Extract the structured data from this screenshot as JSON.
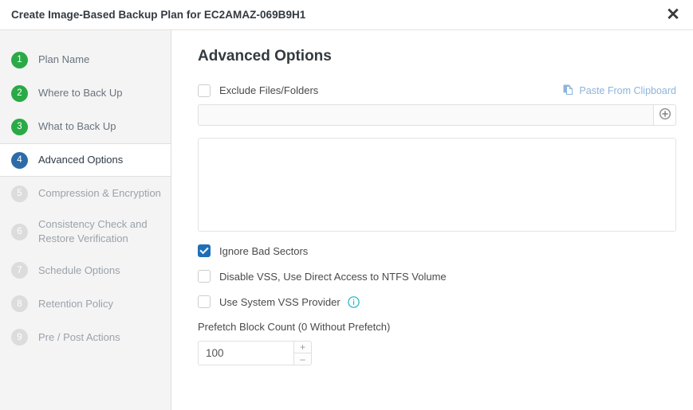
{
  "window": {
    "title": "Create Image-Based Backup Plan for EC2AMAZ-069B9H1",
    "close_label": "✕"
  },
  "sidebar": {
    "items": [
      {
        "number": "1",
        "label": "Plan Name",
        "state": "done"
      },
      {
        "number": "2",
        "label": "Where to Back Up",
        "state": "done"
      },
      {
        "number": "3",
        "label": "What to Back Up",
        "state": "done"
      },
      {
        "number": "4",
        "label": "Advanced Options",
        "state": "active"
      },
      {
        "number": "5",
        "label": "Compression & Encryption",
        "state": "todo"
      },
      {
        "number": "6",
        "label": "Consistency Check and Restore Verification",
        "state": "todo"
      },
      {
        "number": "7",
        "label": "Schedule Options",
        "state": "todo"
      },
      {
        "number": "8",
        "label": "Retention Policy",
        "state": "todo"
      },
      {
        "number": "9",
        "label": "Pre / Post Actions",
        "state": "todo"
      }
    ]
  },
  "main": {
    "heading": "Advanced Options",
    "exclude": {
      "checkbox_label": "Exclude Files/Folders",
      "checked": false,
      "paste_link_label": "Paste From Clipboard",
      "input_value": "",
      "input_placeholder": "",
      "add_button_label": "+",
      "textarea_value": "",
      "textarea_placeholder": ""
    },
    "options": [
      {
        "label": "Ignore Bad Sectors",
        "checked": true,
        "info": false
      },
      {
        "label": "Disable VSS, Use Direct Access to NTFS Volume",
        "checked": false,
        "info": false
      },
      {
        "label": "Use System VSS Provider",
        "checked": false,
        "info": true
      }
    ],
    "prefetch": {
      "label": "Prefetch Block Count (0 Without Prefetch)",
      "value": "100",
      "increment_label": "+",
      "decrement_label": "–"
    }
  },
  "colors": {
    "step_done": "#2aaa47",
    "step_active": "#2b6ca8",
    "step_todo": "#dcdcdc",
    "checkbox_checked": "#1f6fb6",
    "link": "#8cb4dc",
    "info_icon": "#29b6c8",
    "sidebar_bg": "#f4f4f4"
  },
  "icons": {
    "close": "close-icon",
    "paste": "paste-from-clipboard-icon",
    "add": "circle-plus-icon",
    "info": "info-circle-icon"
  }
}
